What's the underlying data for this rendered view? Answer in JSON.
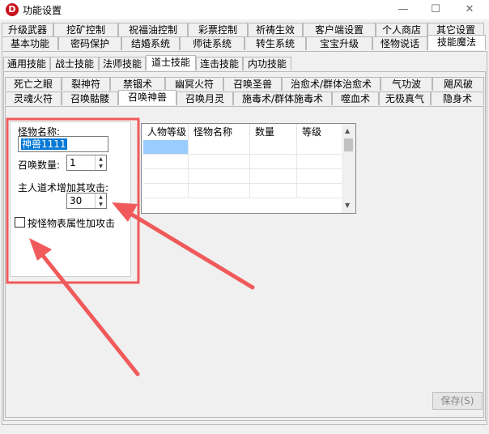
{
  "window": {
    "title": "功能设置",
    "icon": "D",
    "minimize": "—",
    "maximize": "☐",
    "close": "✕"
  },
  "tabs_row1": [
    "升级武器",
    "挖矿控制",
    "祝福油控制",
    "彩票控制",
    "祈祷生效",
    "客户端设置",
    "个人商店",
    "其它设置"
  ],
  "tabs_row2": [
    "基本功能",
    "密码保护",
    "结婚系统",
    "师徒系统",
    "转生系统",
    "宝宝升级",
    "怪物说话",
    "技能魔法"
  ],
  "tabs_row3": [
    "通用技能",
    "战士技能",
    "法师技能",
    "道士技能",
    "连击技能",
    "内功技能"
  ],
  "tabs_row4": [
    "死亡之眼",
    "裂神符",
    "禁锢术",
    "幽冥火符",
    "召唤圣兽",
    "治愈术/群体治愈术",
    "气功波",
    "飓风破"
  ],
  "tabs_row5": [
    "灵魂火符",
    "召唤骷髅",
    "召唤神兽",
    "召唤月灵",
    "施毒术/群体施毒术",
    "噬血术",
    "无极真气",
    "隐身术"
  ],
  "form": {
    "monster_name_label": "怪物名称:",
    "monster_name_value": "神兽1111",
    "summon_count_label": "召唤数量:",
    "summon_count_value": "1",
    "attack_bonus_label": "主人道术增加其攻击:",
    "attack_bonus_value": "30",
    "checkbox_label": "按怪物表属性加攻击"
  },
  "grid": {
    "headers": [
      "人物等级",
      "怪物名称",
      "数量",
      "等级"
    ]
  },
  "save_label": "保存(S)",
  "colors": {
    "annotation": "#f05a5a",
    "selection": "#0078d7"
  }
}
